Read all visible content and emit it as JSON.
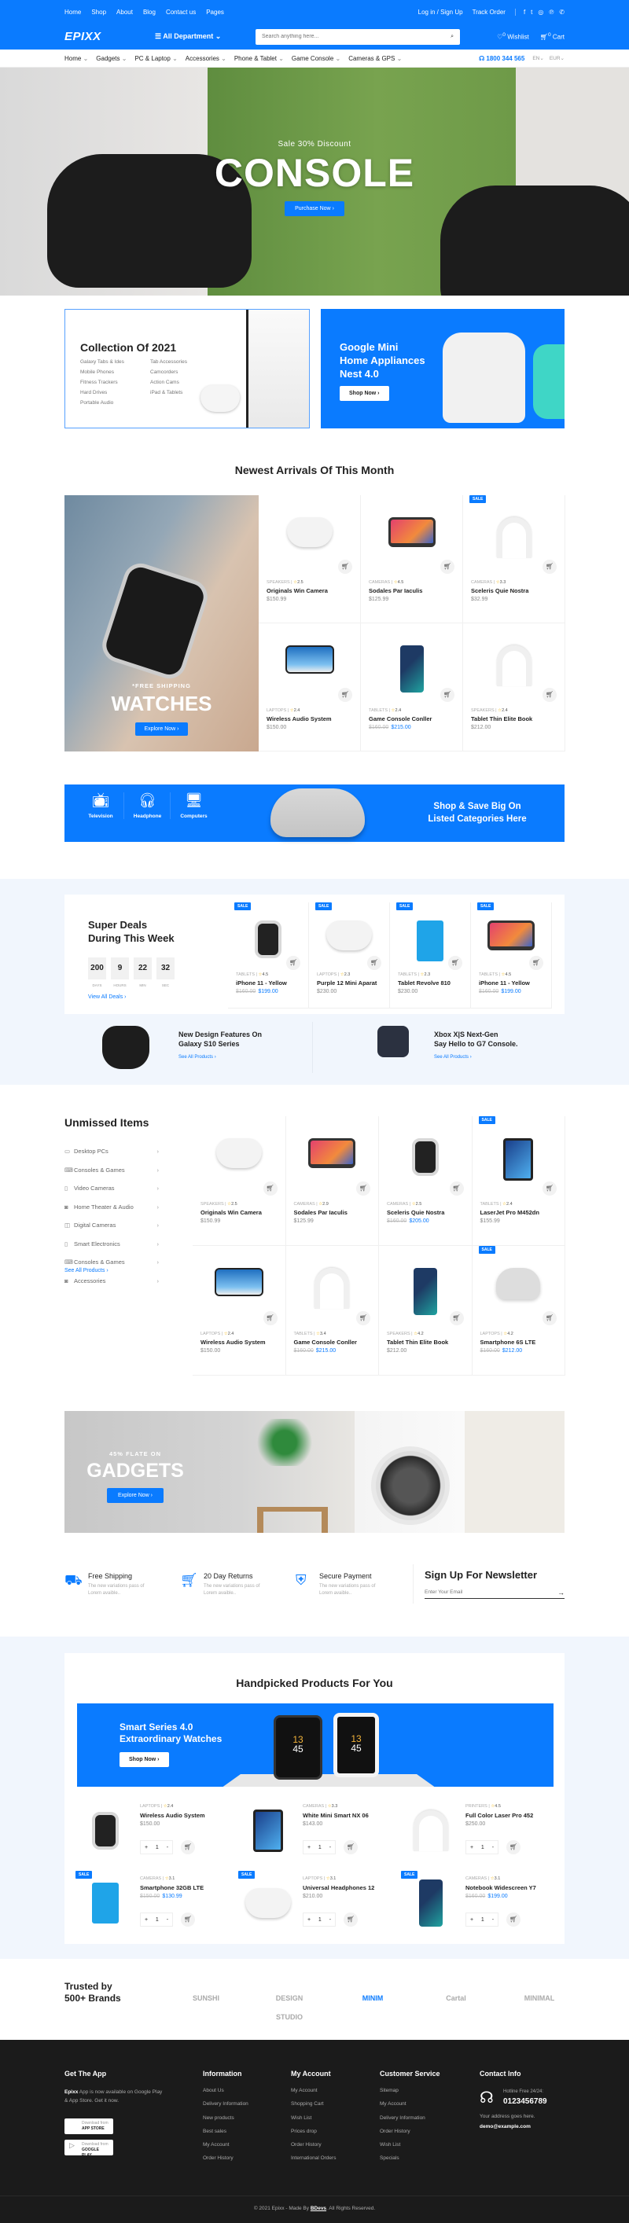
{
  "colors": {
    "accent": "#0a7bff",
    "footer": "#1b1b1b",
    "light_bg": "#f1f6fd"
  },
  "topbar": {
    "links": [
      "Home",
      "Shop",
      "About",
      "Blog",
      "Contact us",
      "Pages"
    ],
    "login": "Log in / Sign Up",
    "track": "Track Order",
    "social_icons": [
      "facebook-icon",
      "twitter-icon",
      "instagram-icon",
      "pinterest-icon",
      "whatsapp-icon"
    ]
  },
  "header": {
    "logo": "EPIXX",
    "department": "All Department",
    "search_placeholder": "Search anything here...",
    "wishlist": "Wishlist",
    "wishlist_count": "0",
    "cart": "Cart",
    "cart_count": "0"
  },
  "nav": {
    "items": [
      "Home",
      "Gadgets",
      "PC & Laptop",
      "Accessories",
      "Phone & Tablet",
      "Game Console",
      "Cameras & GPS"
    ],
    "phone": "1800 344 565",
    "lang": "EN",
    "currency": "EUR"
  },
  "hero": {
    "subtitle": "Sale 30% Discount",
    "title": "CONSOLE",
    "button": "Purchase Now"
  },
  "collection": {
    "title": "Collection Of 2021",
    "col1": [
      "Galaxy Tabs & Ides",
      "Mobile Phones",
      "Fitness Trackers",
      "Hard Drives",
      "Portable Audio"
    ],
    "col2": [
      "Tab Accessories",
      "Camcorders",
      "Action Cams",
      "iPad & Tablets"
    ]
  },
  "nest": {
    "line1": "Google Mini",
    "line2": "Home Appliances",
    "line3": "Nest 4.0",
    "button": "Shop Now"
  },
  "newest": {
    "title": "Newest Arrivals Of This Month",
    "banner": {
      "kicker": "*FREE SHIPPING",
      "title": "WATCHES",
      "button": "Explore Now"
    },
    "products": [
      {
        "cat": "SPEAKERS",
        "rating": "2.5",
        "name": "Originals Win Camera",
        "price": "$150.99",
        "img": "controller"
      },
      {
        "cat": "CAMERAS",
        "rating": "4.5",
        "name": "Sodales Par Iaculis",
        "price": "$125.99",
        "img": "laptop"
      },
      {
        "cat": "CAMERAS",
        "rating": "3.3",
        "name": "Sceleris Quie Nostra",
        "price": "$32.99",
        "img": "headphones",
        "sale": "SALE"
      },
      {
        "cat": "LAPTOPS",
        "rating": "2.4",
        "name": "Wireless Audio System",
        "price": "$150.00",
        "img": "tv"
      },
      {
        "cat": "TABLETS",
        "rating": "2.4",
        "name": "Game Console Conller",
        "old": "$160.00",
        "price": "$215.00",
        "img": "phone"
      },
      {
        "cat": "SPEAKERS",
        "rating": "2.4",
        "name": "Tablet Thin Elite Book",
        "price": "$212.00",
        "img": "headphones"
      }
    ]
  },
  "category_banner": {
    "items": [
      "Television",
      "Headphone",
      "Computers"
    ],
    "headline1": "Shop & Save Big On",
    "headline2": "Listed Categories Here"
  },
  "deals": {
    "title1": "Super Deals",
    "title2": "During This Week",
    "countdown": [
      {
        "v": "200",
        "l": "DAYS"
      },
      {
        "v": "9",
        "l": "HOURS"
      },
      {
        "v": "22",
        "l": "MIN"
      },
      {
        "v": "32",
        "l": "SEC"
      }
    ],
    "link": "View All Deals",
    "products": [
      {
        "cat": "TABLETS",
        "rating": "4.5",
        "name": "iPhone 11 - Yellow",
        "old": "$160.00",
        "price": "$199.00",
        "img": "watch",
        "sale": "SALE"
      },
      {
        "cat": "LAPTOPS",
        "rating": "2.3",
        "name": "Purple 12 Mini Aparat",
        "price": "$230.00",
        "img": "controller",
        "sale": "SALE"
      },
      {
        "cat": "TABLETS",
        "rating": "2.3",
        "name": "Tablet Revolve 810",
        "price": "$230.00",
        "img": "drive",
        "sale": "SALE"
      },
      {
        "cat": "TABLETS",
        "rating": "4.5",
        "name": "iPhone 11 - Yellow",
        "old": "$160.00",
        "price": "$199.00",
        "img": "laptop",
        "sale": "SALE"
      }
    ]
  },
  "promos": [
    {
      "line1": "New Design Features On",
      "line2": "Galaxy S10 Series",
      "link": "See All Products"
    },
    {
      "line1": "Xbox X|S Next-Gen",
      "line2": "Say Hello to G7 Console.",
      "link": "See All Products"
    }
  ],
  "unmissed": {
    "title": "Unmissed Items",
    "categories": [
      "Desktop PCs",
      "Consoles & Games",
      "Video Cameras",
      "Home Theater & Audio",
      "Digital Cameras",
      "Smart Electronics",
      "Consoles & Games",
      "Accessories"
    ],
    "link": "See All Products",
    "products": [
      {
        "cat": "SPEAKERS",
        "rating": "2.5",
        "name": "Originals Win Camera",
        "price": "$150.99",
        "img": "controller"
      },
      {
        "cat": "CAMERAS",
        "rating": "2.9",
        "name": "Sodales Par Iaculis",
        "price": "$125.99",
        "img": "laptop"
      },
      {
        "cat": "CAMERAS",
        "rating": "2.5",
        "name": "Sceleris Quie Nostra",
        "old": "$160.00",
        "price": "$205.00",
        "img": "watch"
      },
      {
        "cat": "TABLETS",
        "rating": "2.4",
        "name": "LaserJet Pro M452dn",
        "price": "$155.99",
        "img": "tablet",
        "sale": "SALE"
      },
      {
        "cat": "LAPTOPS",
        "rating": "2.4",
        "name": "Wireless Audio System",
        "price": "$150.00",
        "img": "tv"
      },
      {
        "cat": "TABLETS",
        "rating": "3.4",
        "name": "Game Console Conller",
        "old": "$160.00",
        "price": "$215.00",
        "img": "headphones"
      },
      {
        "cat": "SPEAKERS",
        "rating": "4.2",
        "name": "Tablet Thin Elite Book",
        "price": "$212.00",
        "img": "phone"
      },
      {
        "cat": "LAPTOPS",
        "rating": "4.2",
        "name": "Smartphone 6S LTE",
        "old": "$160.00",
        "price": "$212.00",
        "img": "speaker",
        "sale": "SALE"
      }
    ]
  },
  "gadgets": {
    "kicker": "45% FLATE ON",
    "title": "GADGETS",
    "button": "Explore Now"
  },
  "features": [
    {
      "title": "Free Shipping",
      "desc": "The new variations pass of Lorem avaible..",
      "icon": "delivery-icon"
    },
    {
      "title": "20 Day Returns",
      "desc": "The new variations pass of Lorem avaible..",
      "icon": "return-cart-icon"
    },
    {
      "title": "Secure Payment",
      "desc": "The new variations pass of Lorem avaible..",
      "icon": "secure-payment-icon"
    }
  ],
  "newsletter": {
    "title": "Sign Up For Newsletter",
    "placeholder": "Enter Your Email"
  },
  "handpicked": {
    "title": "Handpicked Products For You",
    "banner": {
      "line1": "Smart Series 4.0",
      "line2": "Extraordinary Watches",
      "button": "Shop Now",
      "watch_time1": "13",
      "watch_time2": "45"
    },
    "products": [
      {
        "cat": "LAPTOPS",
        "rating": "2.4",
        "name": "Wireless Audio System",
        "price": "$150.00",
        "qty": "1",
        "img": "watch"
      },
      {
        "cat": "CAMERAS",
        "rating": "3.3",
        "name": "White Mini Smart NX 06",
        "price": "$143.00",
        "qty": "1",
        "img": "tablet"
      },
      {
        "cat": "PRINTERS",
        "rating": "4.5",
        "name": "Full Color Laser Pro 452",
        "price": "$250.00",
        "qty": "1",
        "img": "headphones"
      },
      {
        "cat": "CAMERAS",
        "rating": "3.1",
        "name": "Smartphone 32GB LTE",
        "old": "$150.00",
        "price": "$130.99",
        "qty": "1",
        "img": "drive",
        "sale": "SALE"
      },
      {
        "cat": "LAPTOPS",
        "rating": "3.1",
        "name": "Universal Headphones 12",
        "price": "$210.00",
        "qty": "1",
        "img": "controller",
        "sale": "SALE"
      },
      {
        "cat": "CAMERAS",
        "rating": "3.1",
        "name": "Notebook Widescreen Y7",
        "old": "$160.00",
        "price": "$199.00",
        "qty": "1",
        "img": "phone",
        "sale": "SALE"
      }
    ]
  },
  "trusted": {
    "line1": "Trusted by",
    "line2": "500+ Brands",
    "brands": [
      "SUNSHI",
      "DESIGN STUDIO",
      "MINIM",
      "Cartal",
      "MINIMAL"
    ]
  },
  "footer": {
    "app": {
      "title": "Get The App",
      "brand": "Epixx",
      "text": "App is now available on Google Play & App Store. Get it now.",
      "appstore_small": "Download from",
      "appstore": "APP STORE",
      "gplay_small": "Download from",
      "gplay": "GOOGLE PLAY"
    },
    "information": {
      "title": "Information",
      "links": [
        "About Us",
        "Delivery Information",
        "New products",
        "Best sales",
        "My Account",
        "Order History"
      ]
    },
    "account": {
      "title": "My Account",
      "links": [
        "My Account",
        "Shopping Cart",
        "Wish List",
        "Prices drop",
        "Order History",
        "International Orders"
      ]
    },
    "service": {
      "title": "Customer Service",
      "links": [
        "Sitemap",
        "My Account",
        "Delivery Information",
        "Order History",
        "Wish List",
        "Specials"
      ]
    },
    "contact": {
      "title": "Contact Info",
      "hotline_label": "Hotline Free 24/24:",
      "hotline": "0123456789",
      "address": "Your address goes here.",
      "email": "demo@example.com"
    },
    "copyright_pre": "© 2021 Epixx - Made By",
    "copyright_brand": "BDevs",
    "copyright_post": ". All Rights Reserved."
  }
}
